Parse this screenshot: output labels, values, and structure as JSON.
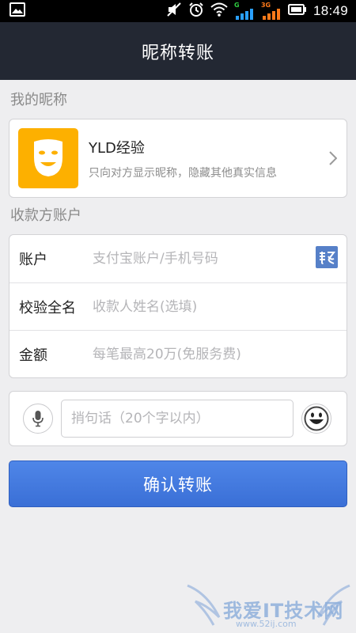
{
  "status_bar": {
    "time": "18:49",
    "network_g_label": "G",
    "network_3g_label": "3G",
    "icons": [
      "image-icon",
      "mute-icon",
      "alarm-icon",
      "wifi-icon",
      "signal-g-icon",
      "signal-3g-icon",
      "battery-icon"
    ],
    "colors": {
      "g": "#2ecc40",
      "3g": "#ff7a1a"
    }
  },
  "header": {
    "title": "昵称转账"
  },
  "nickname_section": {
    "label": "我的昵称",
    "name": "YLD经验",
    "description": "只向对方显示昵称，隐藏其他真实信息",
    "avatar_icon": "mask-smile-icon",
    "avatar_color": "#fdb000"
  },
  "payee_section": {
    "label": "收款方账户",
    "fields": [
      {
        "label": "账户",
        "placeholder": "支付宝账户/手机号码"
      },
      {
        "label": "校验全名",
        "placeholder": "收款人姓名(选填)"
      },
      {
        "label": "金额",
        "placeholder": "每笔最高20万(免服务费)"
      }
    ],
    "contacts_icon": "contacts-book-icon"
  },
  "message": {
    "placeholder": "捎句话（20个字以内）",
    "voice_icon": "microphone-icon",
    "emoji_icon": "smiley-icon"
  },
  "confirm_button": {
    "label": "确认转账",
    "color": "#4a7fe0"
  },
  "watermark": {
    "text": "我爱IT技术网",
    "url": "www.52ij.com"
  }
}
